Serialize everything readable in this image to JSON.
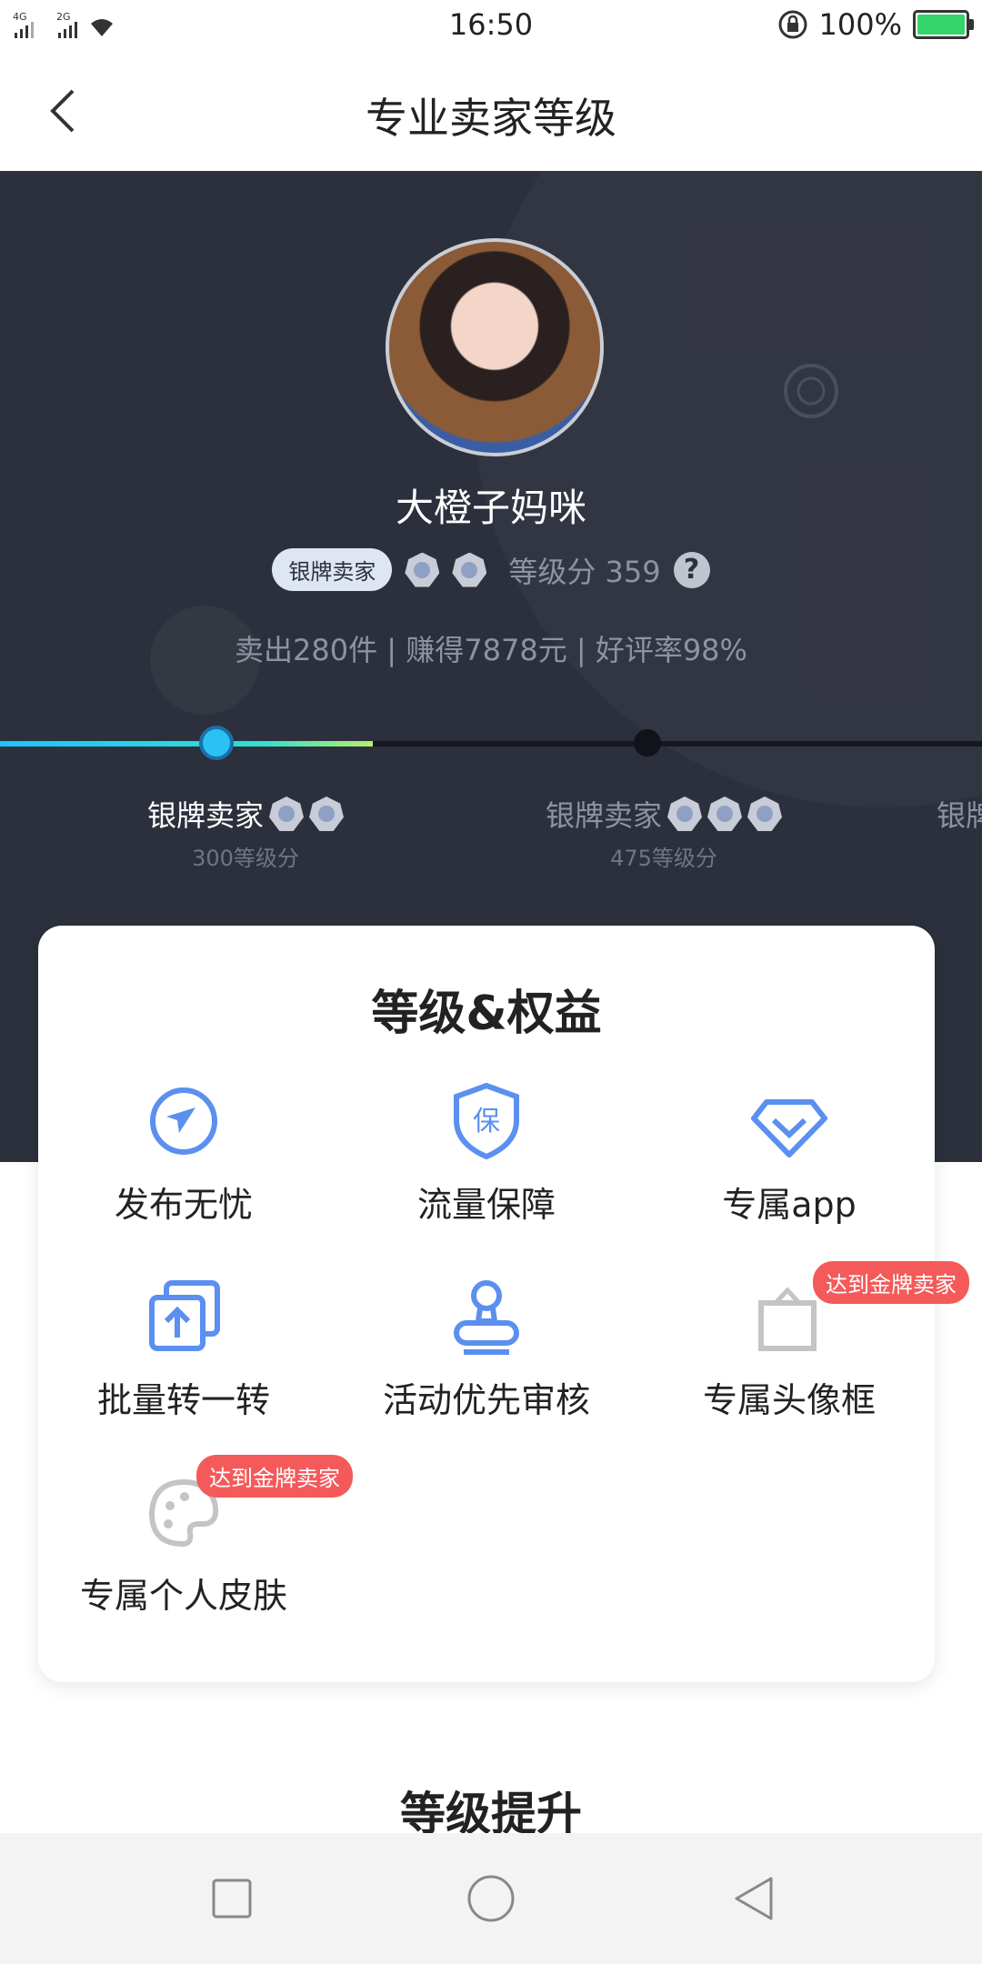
{
  "status_bar": {
    "signal_left": "4G 2G",
    "time": "16:50",
    "battery_text": "100%"
  },
  "header": {
    "title": "专业卖家等级"
  },
  "profile": {
    "nickname": "大橙子妈咪",
    "badge": "银牌卖家",
    "score_label": "等级分 359",
    "help_icon": "?",
    "stats": "卖出280件 | 赚得7878元 | 好评率98%"
  },
  "levels": [
    {
      "name": "银牌卖家",
      "points": "300等级分"
    },
    {
      "name": "银牌卖家",
      "points": "475等级分"
    },
    {
      "name": "银牌"
    }
  ],
  "benefits": {
    "title": "等级&权益",
    "items": [
      {
        "label": "发布无忧",
        "icon": "compass-icon"
      },
      {
        "label": "流量保障",
        "icon": "shield-bao-icon",
        "glyph": "保"
      },
      {
        "label": "专属app",
        "icon": "diamond-icon"
      },
      {
        "label": "批量转一转",
        "icon": "batch-upload-icon"
      },
      {
        "label": "活动优先审核",
        "icon": "stamp-icon"
      },
      {
        "label": "专属头像框",
        "icon": "avatar-frame-icon",
        "tag": "达到金牌卖家"
      },
      {
        "label": "专属个人皮肤",
        "icon": "palette-icon",
        "tag": "达到金牌卖家"
      }
    ]
  },
  "section2": {
    "title": "等级提升"
  },
  "colors": {
    "hero_bg": "#2c303c",
    "accent": "#5b8ff0",
    "tag_red": "#f45a5a",
    "progress": "#1ec2ff"
  }
}
